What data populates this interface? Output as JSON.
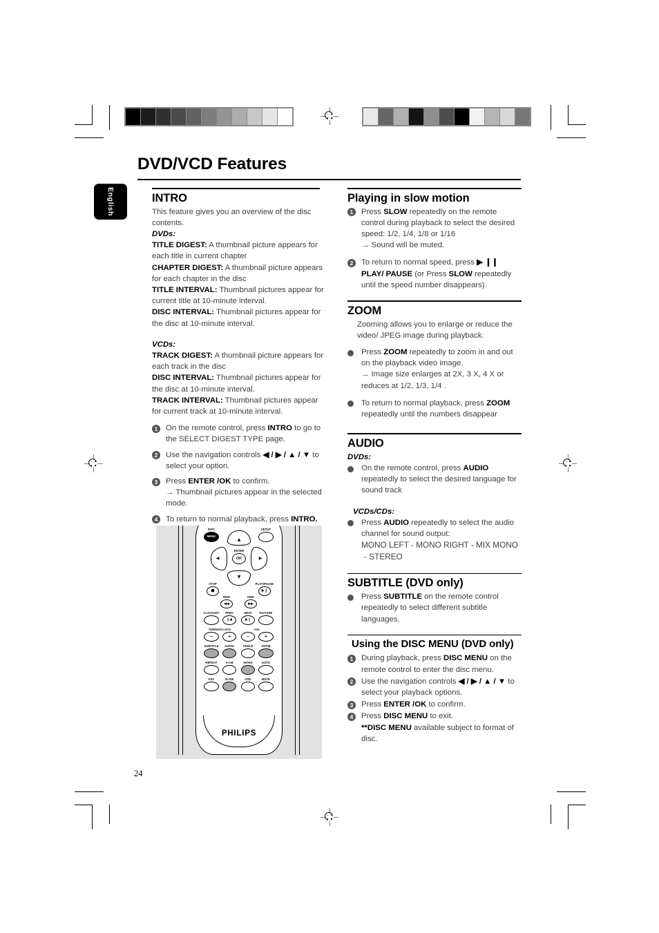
{
  "page": {
    "title": "DVD/VCD Features",
    "language_tab": "English",
    "page_number": "24"
  },
  "left_column": {
    "intro": {
      "heading": "INTRO",
      "lead": "This feature gives you an overview of the disc contents.",
      "dvds_label": "DVDs:",
      "dvd_items": [
        {
          "term": "TITLE DIGEST:",
          "desc": " A thumbnail picture appears for each title in current chapter"
        },
        {
          "term": "CHAPTER DIGEST:",
          "desc": " A thumbnail picture appears for each chapter in the disc"
        },
        {
          "term": "TITLE INTERVAL:",
          "desc": " Thumbnail pictures appear for current title at 10-minute interval."
        },
        {
          "term": "DISC INTERVAL:",
          "desc": " Thumbnail pictures appear for the disc at 10-minute interval."
        }
      ],
      "vcds_label": "VCDs:",
      "vcd_items": [
        {
          "term": "TRACK DIGEST:",
          "desc": " A thumbnail picture appears for each track in the disc"
        },
        {
          "term": "DISC INTERVAL:",
          "desc": " Thumbnail pictures appear for the disc at 10-minute interval."
        },
        {
          "term": "TRACK INTERVAL:",
          "desc": " Thumbnail pictures appear for current track at 10-minute interval."
        }
      ],
      "steps": [
        {
          "num": "1",
          "pre": "On the remote control, press ",
          "key": "INTRO",
          "post": " to go to the SELECT DIGEST TYPE page."
        },
        {
          "num": "2",
          "pre": "Use the navigation controls ",
          "key": "◀ / ▶ / ▲ / ▼",
          "post": " to select your option."
        },
        {
          "num": "3",
          "pre": "Press ",
          "key": "ENTER /OK",
          "post": " to confirm.",
          "result": "→ Thumbnail pictures appear in the selected mode."
        },
        {
          "num": "4",
          "pre": "To return to normal playback, press ",
          "key": "INTRO.",
          "post": ""
        }
      ]
    }
  },
  "right_column": {
    "slow_motion": {
      "heading": "Playing in slow motion",
      "steps": [
        {
          "num": "1",
          "pre": "Press ",
          "key": "SLOW",
          "post": " repeatedly on the remote control during playback to select the desired speed: 1/2, 1/4, 1/8 or 1/16",
          "result": "→ Sound will be muted."
        },
        {
          "num": "2",
          "pre": "To return to normal speed, press ",
          "key": "▶ ❙❙ PLAY/ PAUSE",
          "post": " (or Press ",
          "key2": "SLOW",
          "post2": " repeatedly until the speed number disappears)."
        }
      ]
    },
    "zoom": {
      "heading": "ZOOM",
      "lead": "Zooming allows you to enlarge or reduce the video/ JPEG image during playback.",
      "bullets": [
        {
          "pre": "Press ",
          "key": "ZOOM",
          "post": " repeatedly to zoom in and out on the playback video image.",
          "result": "→ Image size enlarges at 2X, 3 X, 4 X or reduces at 1/2, 1/3, 1/4 ."
        },
        {
          "pre": "To return to normal playback, press ",
          "key": "ZOOM",
          "post": " repeatedly until the numbers disappear"
        }
      ]
    },
    "audio": {
      "heading": "AUDIO",
      "dvds_label": "DVDs:",
      "dvd_bullet": {
        "pre": " On the remote control, press ",
        "key": "AUDIO",
        "post": " repeatedly to select the desired language for sound track"
      },
      "vcds_label": "VCDs/CDs:",
      "vcd_bullet": {
        "pre": "Press ",
        "key": "AUDIO",
        "post": " repeatedly to select the audio channel for sound output:"
      },
      "channels_line1": "MONO LEFT - MONO RIGHT - MIX MONO",
      "channels_line2": "- STEREO"
    },
    "subtitle": {
      "heading": "SUBTITLE (DVD only)",
      "bullet": {
        "pre": "Press ",
        "key": "SUBTITLE",
        "post": " on the remote control repeatedly to select different subtitle languages."
      }
    },
    "disc_menu": {
      "heading": "Using the DISC MENU (DVD only)",
      "steps": [
        {
          "num": "1",
          "pre": "During playback, press ",
          "key": "DISC MENU",
          "post": " on the remote control to enter the disc menu."
        },
        {
          "num": "2",
          "pre": "Use the navigation controls ",
          "key": "◀ / ▶ / ▲ / ▼",
          "post": " to select your playback options."
        },
        {
          "num": "3",
          "pre": "Press ",
          "key": "ENTER /OK",
          "post": " to confirm."
        },
        {
          "num": "4",
          "pre": " Press ",
          "key": "DISC MENU",
          "post": " to exit."
        }
      ],
      "footnote_mark": "**",
      "footnote_key": "DISC MENU",
      "footnote_text": " available subject to format of disc."
    }
  },
  "remote": {
    "brand": "PHILIPS",
    "labels": {
      "disc_menu_top": "DISC",
      "disc_menu": "MENU",
      "setup": "SETUP",
      "enter": "ENTER",
      "ok": "OK",
      "stop": "STOP",
      "play_pause": "PLAY/PAUSE",
      "rew": "REW",
      "fwd": "FWD",
      "clockset": "CLOCKSET",
      "prev": "PREV",
      "next": "NEXT",
      "picture": "PICTURE",
      "tuning_clock": "TUNING/CLOCK",
      "vol": "VOL",
      "subtitle": "SUBTITLE",
      "audio": "AUDIO",
      "angle": "ANGLE",
      "zoom": "ZOOM",
      "repeat": "REPEAT",
      "ab": "A<>B",
      "intro": "INTRO",
      "goto": "GOTO",
      "osc": "OSC",
      "slow": "SLOW",
      "osd": "OSD",
      "mute": "MUTE",
      "minus": "−",
      "plus": "+"
    },
    "glyphs": {
      "up": "▲",
      "down": "▼",
      "left": "◀",
      "right": "▶",
      "stop": "■",
      "play_pause": "▶❙",
      "rew": "◀◀",
      "fwd": "▶▶",
      "prev": "❙◀",
      "next": "▶❙"
    }
  },
  "calibration": {
    "left_strip": [
      "#000000",
      "#1b1b1b",
      "#303030",
      "#4a4a4a",
      "#616161",
      "#7c7c7c",
      "#949494",
      "#adadad",
      "#c7c7c7",
      "#e6e6e6",
      "#ffffff"
    ],
    "right_strip": [
      "#e9e9e9",
      "#666666",
      "#b0b0b0",
      "#141414",
      "#8e8e8e",
      "#4d4d4d",
      "#000000",
      "#f2f2f2",
      "#b4b4b4",
      "#d8d8d8",
      "#777777"
    ]
  }
}
